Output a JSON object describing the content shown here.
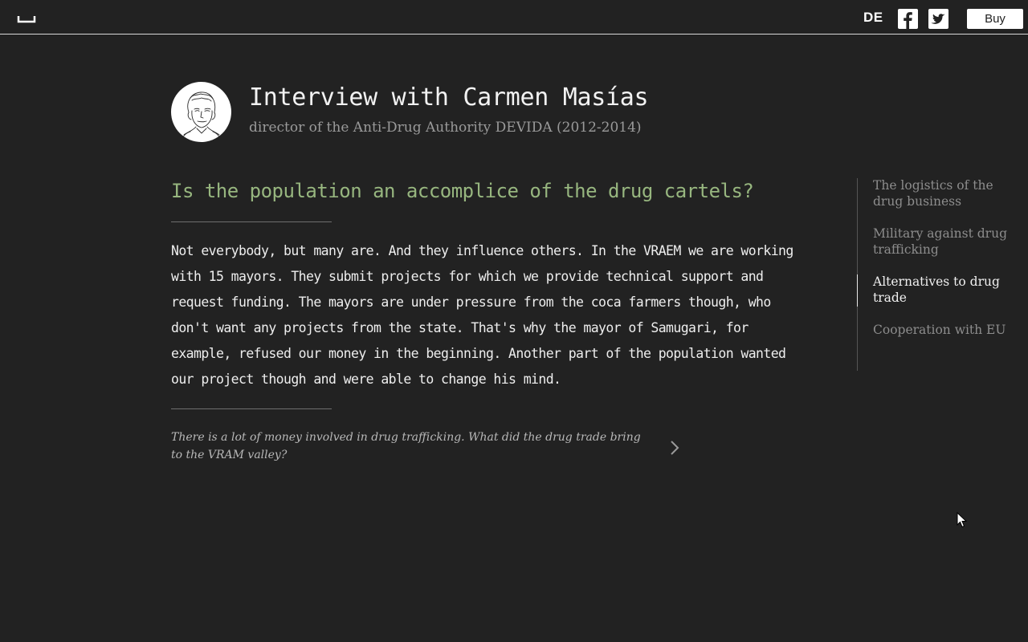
{
  "topbar": {
    "logo_icon": "bracket-logo-icon",
    "language": "DE",
    "facebook_icon": "facebook-icon",
    "twitter_icon": "twitter-icon",
    "buy_label": "Buy"
  },
  "header": {
    "avatar_icon": "portrait-sketch-avatar",
    "title": "Interview with Carmen Masías",
    "subtitle": "director of the Anti-Drug Authority DEVIDA (2012-2014)"
  },
  "main": {
    "question": "Is the population an accomplice of the drug cartels?",
    "answer": "Not everybody, but many are. And they influence others. In the VRAEM we are working with 15 mayors. They submit projects for which we provide technical support and request funding. The mayors are under pressure from the coca farmers though, who don't want any projects from the state. That's why the mayor of Samugari, for example, refused our money in the beginning. Another part of the population wanted our project though and were able to change his mind.",
    "next_question": "There is a lot of money involved in drug trafficking. What did the drug trade bring to the VRAM valley?",
    "next_icon": "chevron-right-icon"
  },
  "sidenav": {
    "items": [
      {
        "label": "The logistics of the drug business",
        "active": false
      },
      {
        "label": "Military against drug trafficking",
        "active": false
      },
      {
        "label": "Alternatives to drug trade",
        "active": true
      },
      {
        "label": "Cooperation with EU",
        "active": false
      }
    ]
  },
  "colors": {
    "background": "#222222",
    "accent_question": "#97b67f",
    "text_primary": "#eeeeee",
    "text_muted": "#8d8d8d"
  }
}
